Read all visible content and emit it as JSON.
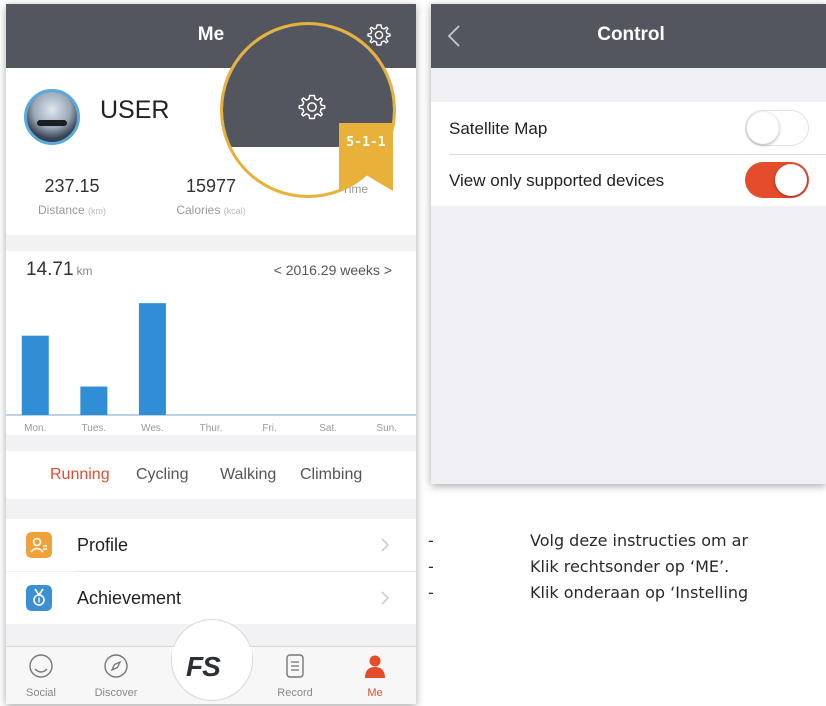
{
  "left_screen": {
    "nav": {
      "title": "Me",
      "settings_icon": "gear-icon"
    },
    "profile": {
      "username": "USER"
    },
    "stats": [
      {
        "value": "237.15",
        "label": "Distance",
        "unit": "(km)"
      },
      {
        "value": "15977",
        "label": "Calories",
        "unit": "(kcal)"
      },
      {
        "value": "",
        "label": "Time",
        "unit": ""
      }
    ],
    "week": {
      "total_value": "14.71",
      "total_unit": "km",
      "range_label": "< 2016.29 weeks >"
    },
    "chart_data": {
      "type": "bar",
      "categories": [
        "Mon.",
        "Tues.",
        "Wes.",
        "Thur.",
        "Fri.",
        "Sat.",
        "Sun."
      ],
      "values": [
        3.9,
        1.4,
        5.5,
        0,
        0,
        0,
        0
      ],
      "title": "",
      "xlabel": "",
      "ylabel": "",
      "ylim": [
        0,
        6
      ],
      "bar_color": "#2f8ed6",
      "grid": false,
      "legend": "none"
    },
    "sport_tabs": [
      {
        "label": "Running",
        "active": true
      },
      {
        "label": "Cycling",
        "active": false
      },
      {
        "label": "Walking",
        "active": false
      },
      {
        "label": "Climbing",
        "active": false
      }
    ],
    "menu": [
      {
        "label": "Profile",
        "icon": "profile-icon",
        "icon_color": "#f0a23a"
      },
      {
        "label": "Achievement",
        "icon": "medal-icon",
        "icon_color": "#3d8fd4"
      }
    ],
    "tabbar": [
      {
        "label": "Social",
        "icon": "social-icon",
        "active": false
      },
      {
        "label": "Discover",
        "icon": "compass-icon",
        "active": false
      },
      {
        "label": "FS",
        "icon": "fs-logo",
        "active": false
      },
      {
        "label": "Record",
        "icon": "record-icon",
        "active": false
      },
      {
        "label": "Me",
        "icon": "person-icon",
        "active": true
      }
    ],
    "callout": {
      "step_label": "5-1-1",
      "ring_color": "#e8b23a"
    }
  },
  "right_screen": {
    "nav": {
      "title": "Control",
      "back_icon": "chevron-left-icon"
    },
    "settings": [
      {
        "label": "Satellite Map",
        "enabled": false
      },
      {
        "label": "View only supported devices",
        "enabled": true
      }
    ]
  },
  "instructions": [
    "Volg deze instructies om ar",
    "Klik rechtsonder op ‘ME’.",
    "Klik onderaan op ‘Instelling"
  ],
  "colors": {
    "nav_bg": "#53565e",
    "accent": "#e44c2c",
    "chart_bar": "#2f8ed6",
    "callout": "#e8b23a"
  }
}
